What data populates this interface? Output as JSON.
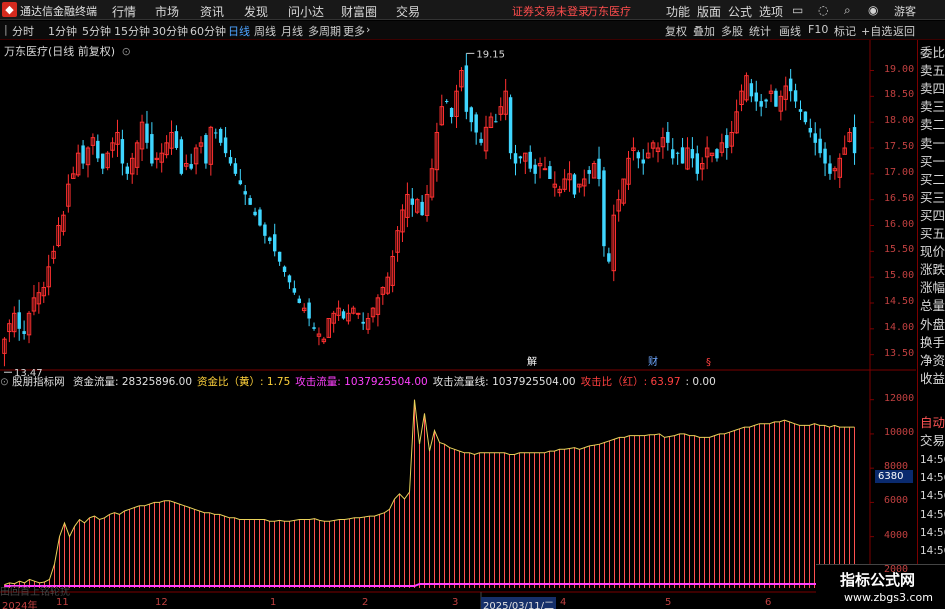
{
  "menubar": {
    "app_title": "通达信金融终端",
    "items": [
      "行情",
      "市场",
      "资讯",
      "发现",
      "问小达",
      "财富圈",
      "交易"
    ],
    "notice": "证券交易未登录",
    "stock": "万东医疗",
    "right_items": [
      "功能",
      "版面",
      "公式",
      "选项"
    ],
    "guest": "游客"
  },
  "periodbar": {
    "tabs": [
      "分时",
      "1分钟",
      "5分钟",
      "15分钟",
      "30分钟",
      "60分钟",
      "日线",
      "周线",
      "月线",
      "多周期",
      "更多"
    ],
    "active": "日线",
    "tools": [
      "复权",
      "叠加",
      "多股",
      "统计",
      "画线",
      "F10",
      "标记",
      "+自选",
      "返回"
    ]
  },
  "price_pane": {
    "title": "万东医疗(日线 前复权)",
    "high_label": "19.15",
    "low_label": "13.47",
    "event_labels": [
      "解",
      "财",
      "§"
    ]
  },
  "indicator_pane": {
    "name": "股朋指标网",
    "fields": [
      {
        "label": "资金流量: 28325896.00",
        "color": "#e0e0e0"
      },
      {
        "label": "资金比（黄）: 1.75",
        "color": "#ffd23c"
      },
      {
        "label": "攻击流量: 1037925504.00",
        "color": "#ff40ff"
      },
      {
        "label": "攻击流量线: 1037925504.00",
        "color": "#e0e0e0"
      },
      {
        "label": "攻击比（红）: 63.97",
        "color": "#ff4040"
      },
      {
        "label": ": 0.00",
        "color": "#e0e0e0"
      }
    ],
    "badge": "6380",
    "bottom_left": "田回首上铭轮扰"
  },
  "right_panel": {
    "items": [
      "委比",
      "卖五",
      "卖四",
      "卖三",
      "卖二",
      "卖一",
      "买一",
      "买二",
      "买三",
      "买四",
      "买五",
      "现价",
      "涨跌",
      "涨幅",
      "总量",
      "外盘",
      "换手",
      "净资",
      "收益"
    ],
    "lower_items": [
      "自动",
      "交易",
      "14:56",
      "14:56",
      "14:56",
      "14:56",
      "14:56",
      "14:56",
      "14:56",
      "14:56",
      "14:56"
    ]
  },
  "x_axis": {
    "labels": [
      "2024年",
      "11",
      "12",
      "1",
      "2",
      "3",
      "2025/03/11/二",
      "4",
      "5",
      "6"
    ]
  },
  "watermark": {
    "line1": "指标公式网",
    "line2": "www.zbgs3.com"
  },
  "colors": {
    "up": "#ff3030",
    "down": "#3fd6ff",
    "axis": "#7a0000",
    "volume_line": "#e8d25a"
  },
  "chart_data": {
    "type": "candlestick",
    "price_axis": {
      "ylim": [
        13.3,
        19.3
      ],
      "ticks": [
        "19.00",
        "18.50",
        "18.00",
        "17.50",
        "17.00",
        "16.50",
        "16.00",
        "15.50",
        "15.00",
        "14.50",
        "14.00",
        "13.50"
      ]
    },
    "close": [
      13.8,
      14.1,
      14.3,
      14.0,
      13.9,
      14.3,
      14.6,
      14.7,
      14.8,
      15.2,
      15.5,
      16.0,
      16.2,
      16.8,
      17.0,
      17.4,
      17.2,
      17.5,
      17.7,
      17.3,
      17.1,
      17.4,
      17.6,
      17.8,
      17.2,
      17.0,
      17.3,
      17.6,
      18.0,
      17.6,
      17.2,
      17.3,
      17.4,
      17.6,
      17.8,
      17.5,
      17.0,
      17.2,
      17.1,
      17.5,
      17.6,
      17.2,
      17.9,
      17.8,
      17.6,
      17.4,
      17.2,
      17.0,
      16.8,
      16.6,
      16.4,
      16.2,
      16.0,
      15.8,
      15.7,
      15.5,
      15.3,
      15.1,
      14.9,
      14.7,
      14.5,
      14.4,
      14.2,
      14.0,
      13.9,
      13.8,
      14.2,
      14.3,
      14.4,
      14.2,
      14.3,
      14.4,
      14.3,
      14.1,
      14.2,
      14.4,
      14.6,
      14.8,
      15.0,
      15.4,
      15.9,
      16.3,
      16.6,
      16.4,
      16.5,
      16.2,
      16.6,
      17.1,
      17.8,
      18.3,
      18.4,
      18.1,
      18.6,
      19.0,
      18.2,
      18.0,
      17.8,
      17.6,
      17.9,
      18.1,
      18.0,
      18.3,
      18.6,
      17.4,
      17.2,
      17.3,
      17.4,
      17.1,
      17.0,
      17.2,
      17.1,
      16.9,
      16.8,
      16.7,
      16.9,
      17.0,
      16.6,
      16.8,
      16.9,
      17.0,
      17.2,
      16.9,
      15.6,
      15.3,
      16.2,
      16.5,
      16.9,
      17.3,
      17.5,
      17.3,
      17.2,
      17.4,
      17.6,
      17.5,
      17.7,
      17.6,
      17.3,
      17.4,
      17.2,
      17.5,
      17.3,
      17.0,
      17.2,
      17.5,
      17.4,
      17.3,
      17.6,
      17.5,
      17.8,
      18.2,
      18.6,
      18.9,
      18.5,
      18.4,
      18.3,
      18.4,
      18.6,
      18.3,
      18.5,
      18.7,
      18.6,
      18.4,
      18.2,
      18.0,
      17.8,
      17.6,
      17.4,
      17.2,
      17.0,
      17.1,
      17.3,
      17.5,
      17.8,
      17.4
    ],
    "indicator_axis": {
      "ylim": [
        1000,
        12800
      ],
      "ticks": [
        "12000",
        "10000",
        "8000",
        "6000",
        "4000",
        "2000"
      ]
    },
    "volume_flow": [
      1200,
      1300,
      1250,
      1400,
      1300,
      1500,
      1400,
      1300,
      1350,
      1500,
      2400,
      4000,
      4800,
      4000,
      4600,
      5000,
      4800,
      5100,
      5200,
      5000,
      5100,
      5300,
      5400,
      5300,
      5500,
      5600,
      5700,
      5800,
      5800,
      5900,
      6000,
      6000,
      6100,
      6100,
      6000,
      5900,
      5800,
      5700,
      5600,
      5500,
      5400,
      5400,
      5300,
      5300,
      5200,
      5100,
      5100,
      5000,
      5000,
      5000,
      5000,
      5000,
      5000,
      4900,
      4900,
      4950,
      4900,
      4900,
      4950,
      5000,
      5000,
      5000,
      5050,
      4950,
      4900,
      4900,
      4950,
      5000,
      5000,
      5050,
      5100,
      5100,
      5150,
      5200,
      5200,
      5300,
      5400,
      5600,
      6200,
      6500,
      6200,
      6600,
      12000,
      9400,
      11200,
      9000,
      10200,
      9500,
      9400,
      9200,
      9100,
      9000,
      8900,
      8900,
      8800,
      8900,
      8900,
      8900,
      8900,
      8900,
      8900,
      8800,
      8800,
      8900,
      8900,
      8900,
      8900,
      8900,
      8900,
      9000,
      9000,
      9100,
      9100,
      9150,
      9200,
      9100,
      9200,
      9300,
      9350,
      9400,
      9500,
      9600,
      9700,
      9800,
      9800,
      9900,
      9900,
      9900,
      9900,
      9950,
      9950,
      10000,
      9800,
      9850,
      9900,
      10000,
      10000,
      9900,
      9900,
      9800,
      9800,
      9800,
      9900,
      10000,
      10000,
      10100,
      10200,
      10300,
      10400,
      10400,
      10500,
      10600,
      10600,
      10600,
      10700,
      10700,
      10800,
      10700,
      10600,
      10500,
      10500,
      10500,
      10600,
      10500,
      10500,
      10400,
      10500,
      10400,
      10400,
      10400,
      10400
    ]
  }
}
